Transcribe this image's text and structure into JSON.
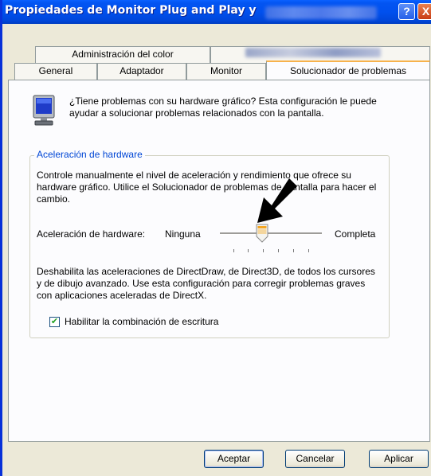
{
  "window": {
    "title": "Propiedades de Monitor Plug and Play y",
    "help_glyph": "?",
    "close_glyph": "X"
  },
  "tabs": {
    "row1": [
      "Administración del color"
    ],
    "row2": [
      "General",
      "Adaptador",
      "Monitor",
      "Solucionador de problemas"
    ],
    "active": "Solucionador de problemas"
  },
  "intro": {
    "icon": "monitor-icon",
    "text": "¿Tiene problemas con su hardware gráfico? Esta configuración le puede ayudar a solucionar problemas relacionados con la pantalla."
  },
  "acceleration": {
    "group_title": "Aceleración de hardware",
    "description": "Controle manualmente el nivel de aceleración y rendimiento que ofrece su hardware gráfico. Utilice el Solucionador de problemas de pantalla para hacer el cambio.",
    "slider_label": "Aceleración de hardware:",
    "min_label": "Ninguna",
    "max_label": "Completa",
    "slider_position": 0.375,
    "ticks": 6,
    "note": "Deshabilita las aceleraciones de DirectDraw, de Direct3D, de todos los cursores y de dibujo avanzado. Use esta configuración para corregir problemas graves con aplicaciones aceleradas de DirectX.",
    "checkbox_label": "Habilitar la combinación de escritura",
    "checkbox_checked": true
  },
  "buttons": {
    "ok": "Aceptar",
    "cancel": "Cancelar",
    "apply": "Aplicar"
  },
  "colors": {
    "titlebar": "#0050ee",
    "group_title": "#0046d5",
    "tab_highlight": "#f7b24c"
  }
}
